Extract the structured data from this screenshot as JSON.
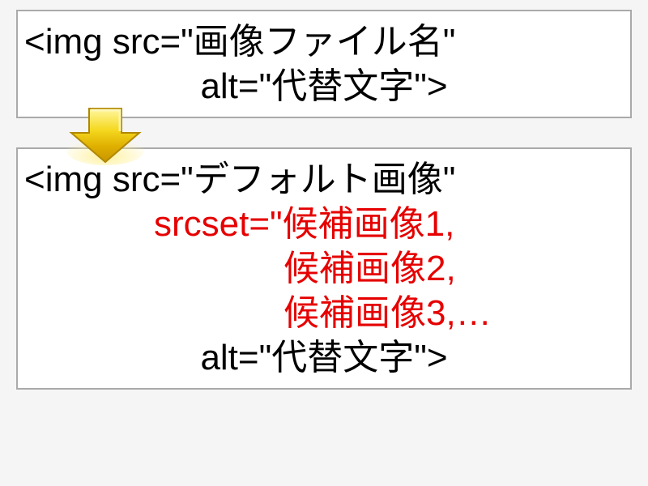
{
  "top": {
    "line1": "<img src=\"画像ファイル名\"",
    "line2": "alt=\"代替文字\">"
  },
  "bottom": {
    "line1": "<img src=\"デフォルト画像\"",
    "line2": "srcset=\"候補画像1,",
    "line3": "候補画像2,",
    "line4": "候補画像3,…",
    "line5": "alt=\"代替文字\">"
  }
}
